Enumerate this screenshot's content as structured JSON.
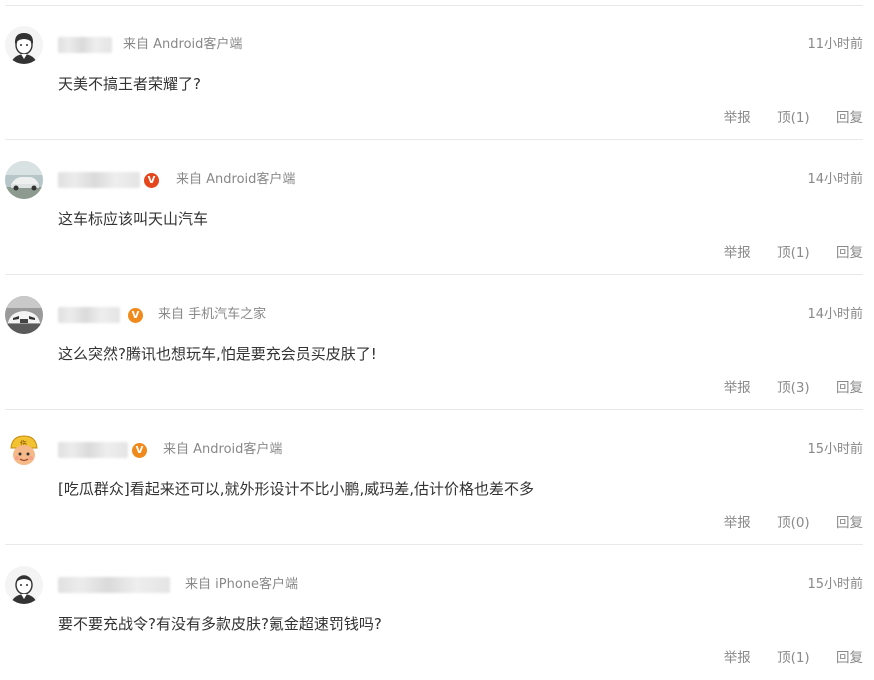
{
  "comments": [
    {
      "source": "来自 Android客户端",
      "time": "11小时前",
      "content": "天美不搞王者荣耀了?",
      "report": "举报",
      "upvote": "顶(1)",
      "reply": "回复",
      "avatar": "default-avatar-icon",
      "verified": false
    },
    {
      "source": "来自 Android客户端",
      "time": "14小时前",
      "content": "这车标应该叫天山汽车",
      "report": "举报",
      "upvote": "顶(1)",
      "reply": "回复",
      "avatar": "car-photo-avatar",
      "verified": true,
      "badge": "V",
      "badge_color": "#e6461c"
    },
    {
      "source": "来自 手机汽车之家",
      "time": "14小时前",
      "content": "这么突然?腾讯也想玩车,怕是要充会员买皮肤了!",
      "report": "举报",
      "upvote": "顶(3)",
      "reply": "回复",
      "avatar": "car-front-photo-avatar",
      "verified": true,
      "badge": "V",
      "badge_color": "#f08a1c"
    },
    {
      "source": "来自 Android客户端",
      "time": "15小时前",
      "content": "[吃瓜群众]看起来还可以,就外形设计不比小鹏,威玛差,估计价格也差不多",
      "report": "举报",
      "upvote": "顶(0)",
      "reply": "回复",
      "avatar": "cartoon-helmet-avatar",
      "verified": true,
      "badge": "V",
      "badge_color": "#f08a1c"
    },
    {
      "source": "来自 iPhone客户端",
      "time": "15小时前",
      "content": "要不要充战令?有没有多款皮肤?氪金超速罚钱吗?",
      "report": "举报",
      "upvote": "顶(1)",
      "reply": "回复",
      "avatar": "default-avatar-icon",
      "verified": false
    }
  ]
}
